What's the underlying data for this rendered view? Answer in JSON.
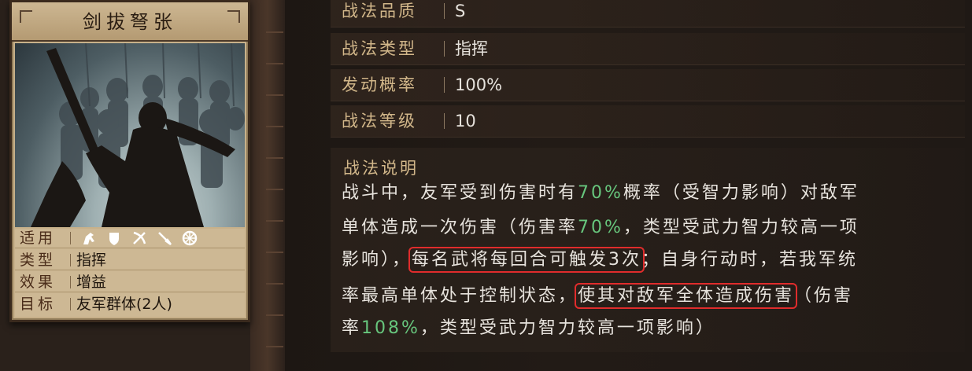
{
  "skill_card": {
    "title": "剑拔弩张",
    "applicable_label": "适用",
    "applicable_icons": [
      "cavalry-icon",
      "shield-icon",
      "bow-icon",
      "spear-icon",
      "siege-icon"
    ],
    "type_label": "类型",
    "type_value": "指挥",
    "effect_label": "效果",
    "effect_value": "增益",
    "target_label": "目标",
    "target_value": "友军群体(2人)"
  },
  "stats": [
    {
      "label": "战法品质",
      "value": "S"
    },
    {
      "label": "战法类型",
      "value": "指挥"
    },
    {
      "label": "发动概率",
      "value": "100%"
    },
    {
      "label": "战法等级",
      "value": "10"
    }
  ],
  "description": {
    "title": "战法说明",
    "l1a": "战斗中，友军受到伤害时有",
    "l1b": "70%",
    "l1c": "概率（受智力影响）对敌军",
    "l2a": "单体造成一次伤害（伤害率",
    "l2b": "70%",
    "l2c": "，类型受武力智力较高一项",
    "l3a": "影响），",
    "l3b": "每名武将每回合可触发3次",
    "l3c": "；自身行动时，若我军统",
    "l4a": "率最高单体处于控制状态，",
    "l4b": "使其对敌军全体造成伤害",
    "l4c": "（伤害",
    "l5a": "率",
    "l5b": "108%",
    "l5c": "，类型受武力智力较高一项影响）"
  },
  "colors": {
    "highlight": "#67c67d",
    "annotation_box": "#e02c2c"
  }
}
